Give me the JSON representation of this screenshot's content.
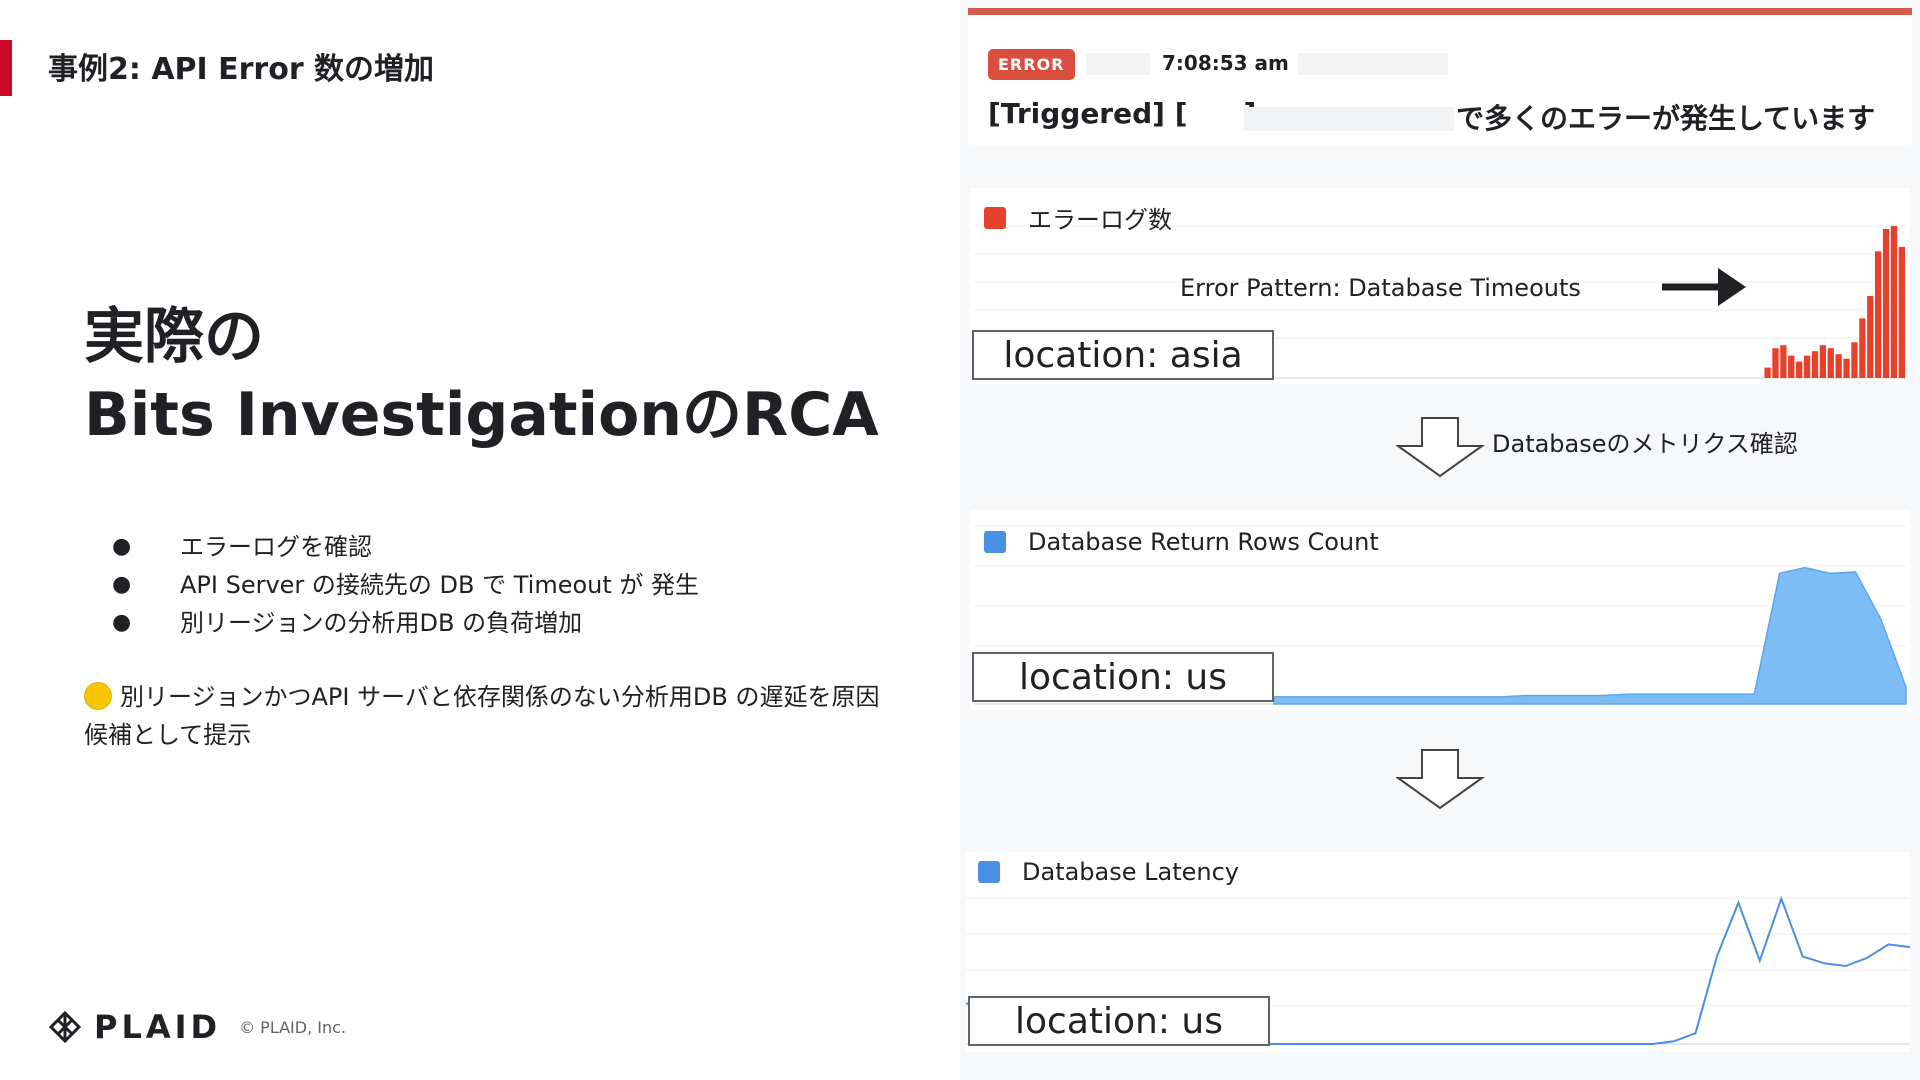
{
  "slide": {
    "header_title": "事例2: API Error 数の増加",
    "main_title_line1": "実際の",
    "main_title_line2": "Bits InvestigationのRCA",
    "bullets": [
      "エラーログを確認",
      "API Server の接続先の DB で Timeout が 発生",
      "別リージョンの分析用DB の負荷増加"
    ],
    "conclusion": "別リージョンかつAPI サーバと依存関係のない分析用DB の遅延を原因候補として提示",
    "footer": {
      "logo_text": "PLAID",
      "copyright": "© PLAID, Inc."
    }
  },
  "alert": {
    "badge": "ERROR",
    "time": "7:08:53 am",
    "title_prefix": "[Triggered] [",
    "title_bracket_close": "]",
    "title_suffix": "で多くのエラーが発生しています",
    "accent_color": "#d55b4b"
  },
  "charts": [
    {
      "legend": "エラーログ数",
      "color": "#e8412b",
      "location": "location: asia",
      "annotation": "Error Pattern: Database Timeouts"
    },
    {
      "legend": "Database Return Rows Count",
      "color": "#7dbcf5",
      "location": "location: us"
    },
    {
      "legend": "Database Latency",
      "color": "#4a90e2",
      "location": "location: us"
    }
  ],
  "flow": {
    "step_label": "Databaseのメトリクス確認"
  },
  "chart_data": [
    {
      "type": "bar",
      "series": [
        {
          "name": "エラーログ数",
          "values": [
            0,
            0,
            0,
            0,
            0,
            0,
            0,
            0,
            0,
            0,
            0,
            0,
            0,
            0,
            0,
            0,
            0,
            0,
            0,
            0,
            0,
            0,
            0,
            0,
            0,
            0,
            0,
            0,
            0,
            0,
            0,
            0,
            0,
            0,
            0,
            0,
            0,
            0,
            0,
            0,
            0,
            0,
            0,
            0,
            0,
            0,
            0,
            0,
            0,
            0,
            0,
            0,
            0,
            0,
            0,
            0,
            0,
            0,
            0,
            0,
            0,
            0,
            0,
            0,
            0,
            0,
            0,
            0,
            0,
            0,
            0,
            0,
            0,
            0,
            0,
            0,
            0,
            0,
            0,
            0,
            0,
            0,
            0,
            0,
            0,
            0,
            0,
            0,
            0,
            0,
            0,
            0,
            0,
            0,
            0,
            0,
            0,
            0,
            0,
            0,
            7,
            20,
            22,
            15,
            11,
            15,
            18,
            22,
            20,
            16,
            13,
            24,
            40,
            55,
            85,
            100,
            102,
            88
          ]
        }
      ]
    },
    {
      "type": "area",
      "series": [
        {
          "name": "Database Return Rows Count",
          "values": [
            5,
            5,
            5,
            5,
            5,
            5,
            5,
            5,
            5,
            5,
            6,
            6,
            6,
            6,
            7,
            7,
            7,
            7,
            7,
            7,
            92,
            96,
            92,
            93,
            60,
            12
          ]
        }
      ]
    },
    {
      "type": "line",
      "series": [
        {
          "name": "Database Latency",
          "values": [
            30,
            29,
            0,
            0,
            0,
            0,
            0,
            0,
            0,
            0,
            0,
            0,
            0,
            0,
            0,
            0,
            0,
            0,
            0,
            0,
            0,
            0,
            0,
            0,
            0,
            0,
            0,
            0,
            0,
            0,
            0,
            0,
            0,
            2,
            8,
            65,
            105,
            62,
            108,
            65,
            60,
            58,
            64,
            74,
            72
          ]
        }
      ]
    }
  ]
}
